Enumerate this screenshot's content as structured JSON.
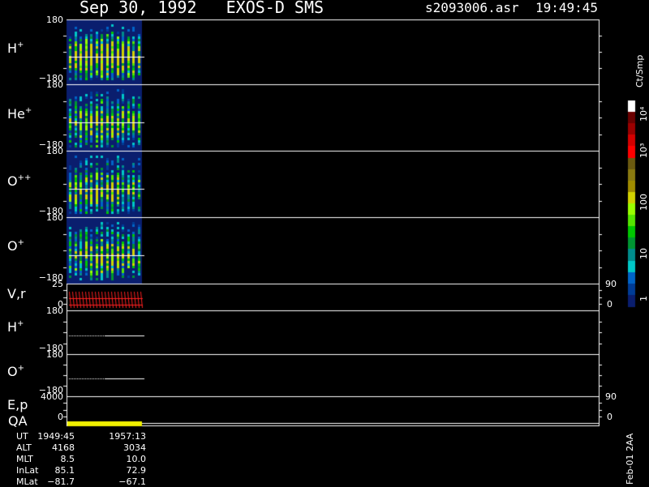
{
  "header": {
    "title": "Sep 30, 1992   EXOS-D SMS",
    "file": "s2093006.asr",
    "time": "19:49:45"
  },
  "panels": [
    {
      "label": "H",
      "sup": "+",
      "ytop": "180",
      "ybot": "−180"
    },
    {
      "label": "He",
      "sup": "+",
      "ytop": "180",
      "ybot": "−180"
    },
    {
      "label": "O",
      "sup": "++",
      "ytop": "180",
      "ybot": "−180"
    },
    {
      "label": "O",
      "sup": "+",
      "ytop": "180",
      "ybot": "−180"
    },
    {
      "label": "V,r",
      "sup": "",
      "ytop": "25",
      "ybot": "0",
      "rtop": "90",
      "rbot": "0"
    },
    {
      "label": "H",
      "sup": "+",
      "ytop": "180",
      "ybot": "−180"
    },
    {
      "label": "O",
      "sup": "+",
      "ytop": "180",
      "ybot": "−180"
    },
    {
      "label": "E,p",
      "sup": "",
      "ytop": "4000",
      "ybot": "0",
      "rtop": "90",
      "rbot": "0"
    }
  ],
  "qa_label": "QA",
  "colorbar": {
    "unit": "Ct/Smp",
    "ticks": [
      "10⁴",
      "10³",
      "100",
      "10",
      "1"
    ],
    "colors": [
      "#ffffff",
      "#6b0000",
      "#9a0000",
      "#d40000",
      "#ff0000",
      "#6b5a10",
      "#8a7a10",
      "#a08c00",
      "#d2d200",
      "#9aff00",
      "#55e600",
      "#00c800",
      "#009632",
      "#008c8c",
      "#00c8c8",
      "#0064c8",
      "#003c96",
      "#0a1e6e"
    ]
  },
  "info_table": {
    "labels": [
      "UT",
      "ALT",
      "MLT",
      "InLat",
      "MLat"
    ],
    "start": [
      "1949:45",
      "4168",
      "8.5",
      "85.1",
      "−81.7"
    ],
    "end": [
      "1957:13",
      "3034",
      "10.0",
      "72.9",
      "−67.1"
    ]
  },
  "footer_code": "Feb-01 2AA",
  "chart_data": {
    "type": "heatmap",
    "title": "Sep 30, 1992   EXOS-D SMS",
    "x_time_range": [
      "1949:45",
      "1957:13"
    ],
    "panels": [
      {
        "name": "H+",
        "ylim": [
          -180,
          180
        ],
        "dominant_level": "10-100 Ct/Smp, peak near 100"
      },
      {
        "name": "He+",
        "ylim": [
          -180,
          180
        ],
        "dominant_level": "1-10 Ct/Smp"
      },
      {
        "name": "O++",
        "ylim": [
          -180,
          180
        ],
        "dominant_level": "1-10 Ct/Smp"
      },
      {
        "name": "O+",
        "ylim": [
          -180,
          180
        ],
        "dominant_level": "1-10 Ct/Smp"
      },
      {
        "name": "V,r",
        "ylim": [
          0,
          25
        ],
        "right_ylim": [
          0,
          90
        ]
      },
      {
        "name": "H+",
        "ylim": [
          -180,
          180
        ]
      },
      {
        "name": "O+",
        "ylim": [
          -180,
          180
        ]
      },
      {
        "name": "E,p",
        "ylim": [
          0,
          4000
        ],
        "right_ylim": [
          0,
          90
        ]
      }
    ],
    "colorbar": {
      "unit": "Ct/Smp",
      "scale": "log",
      "range": [
        1,
        10000
      ]
    }
  }
}
